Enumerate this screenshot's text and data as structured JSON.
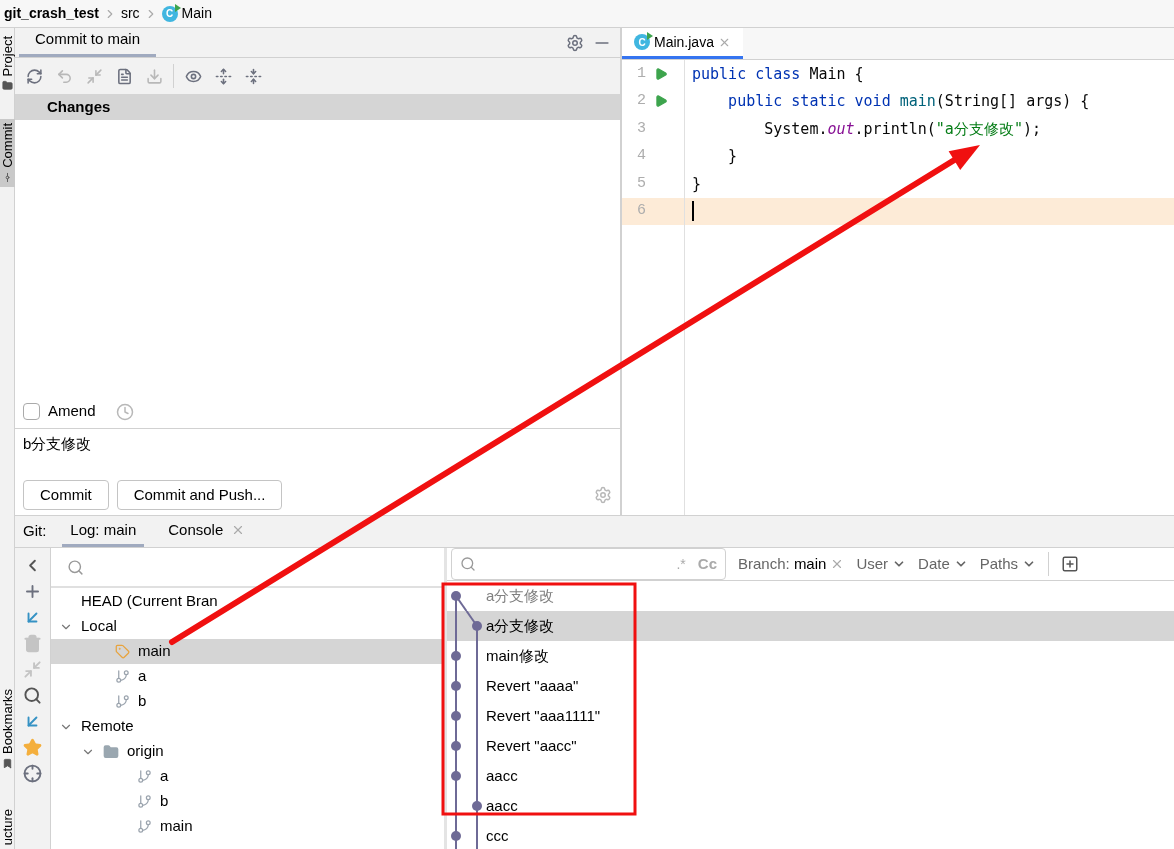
{
  "breadcrumbs": [
    {
      "label": "git_crash_test",
      "kind": "project"
    },
    {
      "label": "src",
      "kind": "folder"
    },
    {
      "label": "Main",
      "kind": "class",
      "icon_letter": "C"
    }
  ],
  "side_strip": {
    "top": [
      {
        "label": "Project",
        "selected": false,
        "kind": "project"
      },
      {
        "label": "Commit",
        "selected": true,
        "kind": "commit"
      }
    ],
    "bottom": [
      {
        "label": "Bookmarks",
        "selected": false,
        "kind": "bookmarks"
      },
      {
        "label": "ucture",
        "selected": false,
        "kind": "structure"
      }
    ]
  },
  "commit_panel": {
    "title": "Commit to main",
    "changes_header": "Changes",
    "amend": {
      "label": "Amend",
      "checked": false
    },
    "message": "b分支修改",
    "buttons": [
      "Commit",
      "Commit and Push..."
    ]
  },
  "editor": {
    "tab": {
      "label": "Main.java",
      "icon_letter": "C",
      "selected": true
    },
    "lines": [
      {
        "number": "1",
        "run_icon": true,
        "current": false,
        "tokens": [
          {
            "text": "public class",
            "kind": "keyword"
          },
          {
            "text": " Main {",
            "kind": "plain"
          }
        ]
      },
      {
        "number": "2",
        "run_icon": true,
        "current": false,
        "tokens": [
          {
            "text": "    public static void",
            "kind": "keyword"
          },
          {
            "text": " main",
            "kind": "method"
          },
          {
            "text": "(String[] args) {",
            "kind": "plain"
          }
        ]
      },
      {
        "number": "3",
        "run_icon": false,
        "current": false,
        "tokens": [
          {
            "text": "        System.",
            "kind": "plain"
          },
          {
            "text": "out",
            "kind": "field"
          },
          {
            "text": ".println(",
            "kind": "plain"
          },
          {
            "text": "\"a分支修改\"",
            "kind": "string"
          },
          {
            "text": ");",
            "kind": "plain"
          }
        ]
      },
      {
        "number": "4",
        "run_icon": false,
        "current": false,
        "tokens": [
          {
            "text": "    }",
            "kind": "plain"
          }
        ]
      },
      {
        "number": "5",
        "run_icon": false,
        "current": false,
        "tokens": [
          {
            "text": "}",
            "kind": "plain"
          }
        ]
      },
      {
        "number": "6",
        "run_icon": false,
        "current": true
      }
    ]
  },
  "git_panel": {
    "label": "Git:",
    "tabs": [
      {
        "label": "Log: main",
        "selected": true,
        "closable": false
      },
      {
        "label": "Console",
        "selected": false,
        "closable": true
      }
    ],
    "branches": [
      {
        "label": "HEAD (Current Bran",
        "selected": false
      },
      {
        "label": "Local",
        "expanded": true,
        "selected": false,
        "children": [
          {
            "label": "main",
            "kind": "current",
            "selected": true
          },
          {
            "label": "a",
            "kind": "branch",
            "selected": false
          },
          {
            "label": "b",
            "kind": "branch",
            "selected": false
          }
        ]
      },
      {
        "label": "Remote",
        "expanded": true,
        "selected": false,
        "children": [
          {
            "label": "origin",
            "kind": "folder",
            "expanded": true,
            "selected": false,
            "children": [
              {
                "label": "a",
                "kind": "branch",
                "selected": false
              },
              {
                "label": "b",
                "kind": "branch",
                "selected": false
              },
              {
                "label": "main",
                "kind": "branch",
                "selected": false
              }
            ]
          }
        ]
      }
    ],
    "log_search": {
      "regex_toggle": ".*",
      "case_toggle": "Cc"
    },
    "filters": {
      "branch_label": "Branch:",
      "branch_value": "main",
      "others": [
        "User",
        "Date",
        "Paths"
      ]
    },
    "commits": [
      {
        "message": "a分支修改",
        "side_lane": false,
        "selected": false,
        "dimmed": true
      },
      {
        "message": "a分支修改",
        "side_lane": true,
        "selected": true,
        "dimmed": false
      },
      {
        "message": "main修改",
        "side_lane": false,
        "selected": false,
        "dimmed": false
      },
      {
        "message": "Revert \"aaaa\"",
        "side_lane": false,
        "selected": false,
        "dimmed": false
      },
      {
        "message": "Revert \"aaa1111\"",
        "side_lane": false,
        "selected": false,
        "dimmed": false
      },
      {
        "message": "Revert \"aacc\"",
        "side_lane": false,
        "selected": false,
        "dimmed": false
      },
      {
        "message": "aacc",
        "side_lane": false,
        "selected": false,
        "dimmed": false
      },
      {
        "message": "aacc",
        "side_lane": true,
        "selected": false,
        "dimmed": false
      },
      {
        "message": "ccc",
        "side_lane": false,
        "selected": false,
        "dimmed": false
      }
    ]
  }
}
